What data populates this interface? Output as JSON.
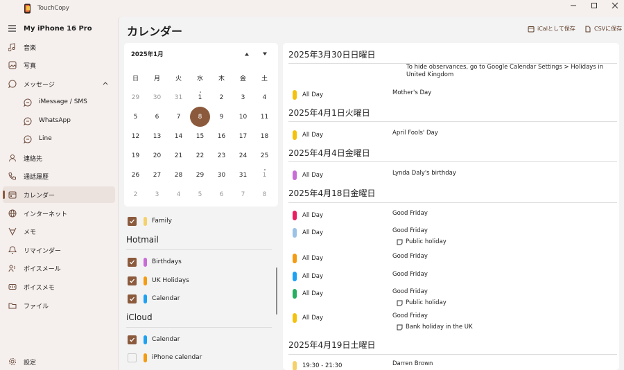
{
  "app": {
    "title": "TouchCopy",
    "device": "My iPhone 16 Pro"
  },
  "sidebar": {
    "items": [
      {
        "label": "音楽",
        "icon": "music-icon"
      },
      {
        "label": "写真",
        "icon": "photo-icon"
      },
      {
        "label": "メッセージ",
        "icon": "message-icon"
      },
      {
        "label": "iMessage / SMS",
        "icon": "chat-icon"
      },
      {
        "label": "WhatsApp",
        "icon": "chat-icon"
      },
      {
        "label": "Line",
        "icon": "chat-icon"
      },
      {
        "label": "連絡先",
        "icon": "contact-icon"
      },
      {
        "label": "通話履歴",
        "icon": "phone-icon"
      },
      {
        "label": "カレンダー",
        "icon": "calendar-icon"
      },
      {
        "label": "インターネット",
        "icon": "globe-icon"
      },
      {
        "label": "メモ",
        "icon": "note-icon"
      },
      {
        "label": "リマインダー",
        "icon": "bell-icon"
      },
      {
        "label": "ボイスメール",
        "icon": "voicemail-icon"
      },
      {
        "label": "ボイスメモ",
        "icon": "voicememo-icon"
      },
      {
        "label": "ファイル",
        "icon": "folder-icon"
      }
    ],
    "settings": "設定"
  },
  "header": {
    "title": "カレンダー",
    "ical_button": "iCalとして保存",
    "csv_button": "CSVに保存"
  },
  "calendar": {
    "month_label": "2025年1月",
    "weekdays": [
      "日",
      "月",
      "火",
      "水",
      "木",
      "金",
      "土"
    ],
    "weeks": [
      [
        "29",
        "30",
        "31",
        "1",
        "2",
        "3",
        "4"
      ],
      [
        "5",
        "6",
        "7",
        "8",
        "9",
        "10",
        "11"
      ],
      [
        "12",
        "13",
        "14",
        "15",
        "16",
        "17",
        "18"
      ],
      [
        "19",
        "20",
        "21",
        "22",
        "23",
        "24",
        "25"
      ],
      [
        "26",
        "27",
        "28",
        "29",
        "30",
        "31",
        "1"
      ],
      [
        "2",
        "3",
        "4",
        "5",
        "6",
        "7",
        "8"
      ]
    ],
    "selected": "8"
  },
  "calendar_list": {
    "items_top": [
      {
        "name": "Family",
        "color": "#f5d16b",
        "checked": true
      }
    ],
    "groups": [
      {
        "name": "Hotmail",
        "items": [
          {
            "name": "Birthdays",
            "color": "#c86dd7",
            "checked": true
          },
          {
            "name": "UK Holidays",
            "color": "#f39c12",
            "checked": true
          },
          {
            "name": "Calendar",
            "color": "#1da1f2",
            "checked": true
          }
        ]
      },
      {
        "name": "iCloud",
        "items": [
          {
            "name": "Calendar",
            "color": "#1da1f2",
            "checked": true
          },
          {
            "name": "iPhone calendar",
            "color": "#f39c12",
            "checked": false
          }
        ]
      }
    ]
  },
  "events": {
    "top_note": "To hide observances, go to Google Calendar Settings > Holidays in United Kingdom",
    "days": [
      {
        "date": "2025年3月30日日曜日",
        "events": [
          {
            "time": "All Day",
            "title": "Mother's Day",
            "color": "#f4c20d"
          }
        ]
      },
      {
        "date": "2025年4月1日火曜日",
        "events": [
          {
            "time": "All Day",
            "title": "April Fools' Day",
            "color": "#f4c20d"
          }
        ]
      },
      {
        "date": "2025年4月4日金曜日",
        "events": [
          {
            "time": "All Day",
            "title": "Lynda Daly's birthday",
            "color": "#c86dd7"
          }
        ]
      },
      {
        "date": "2025年4月18日金曜日",
        "events": [
          {
            "time": "All Day",
            "title": "Good Friday",
            "color": "#e91e63"
          },
          {
            "time": "All Day",
            "title": "Good Friday",
            "note": "Public holiday",
            "color": "#9cc3e6"
          },
          {
            "time": "All Day",
            "title": "Good Friday",
            "color": "#f39c12"
          },
          {
            "time": "All Day",
            "title": "Good Friday",
            "color": "#1da1f2"
          },
          {
            "time": "All Day",
            "title": "Good Friday",
            "note": "Public holiday",
            "color": "#27ae60"
          },
          {
            "time": "All Day",
            "title": "Good Friday",
            "note": "Bank holiday in the UK",
            "color": "#f4c20d"
          }
        ]
      },
      {
        "date": "2025年4月19日土曜日",
        "events": [
          {
            "time": "19:30 - 21:30",
            "title": "Darren Brown",
            "color": "#f5d16b"
          }
        ]
      }
    ]
  }
}
